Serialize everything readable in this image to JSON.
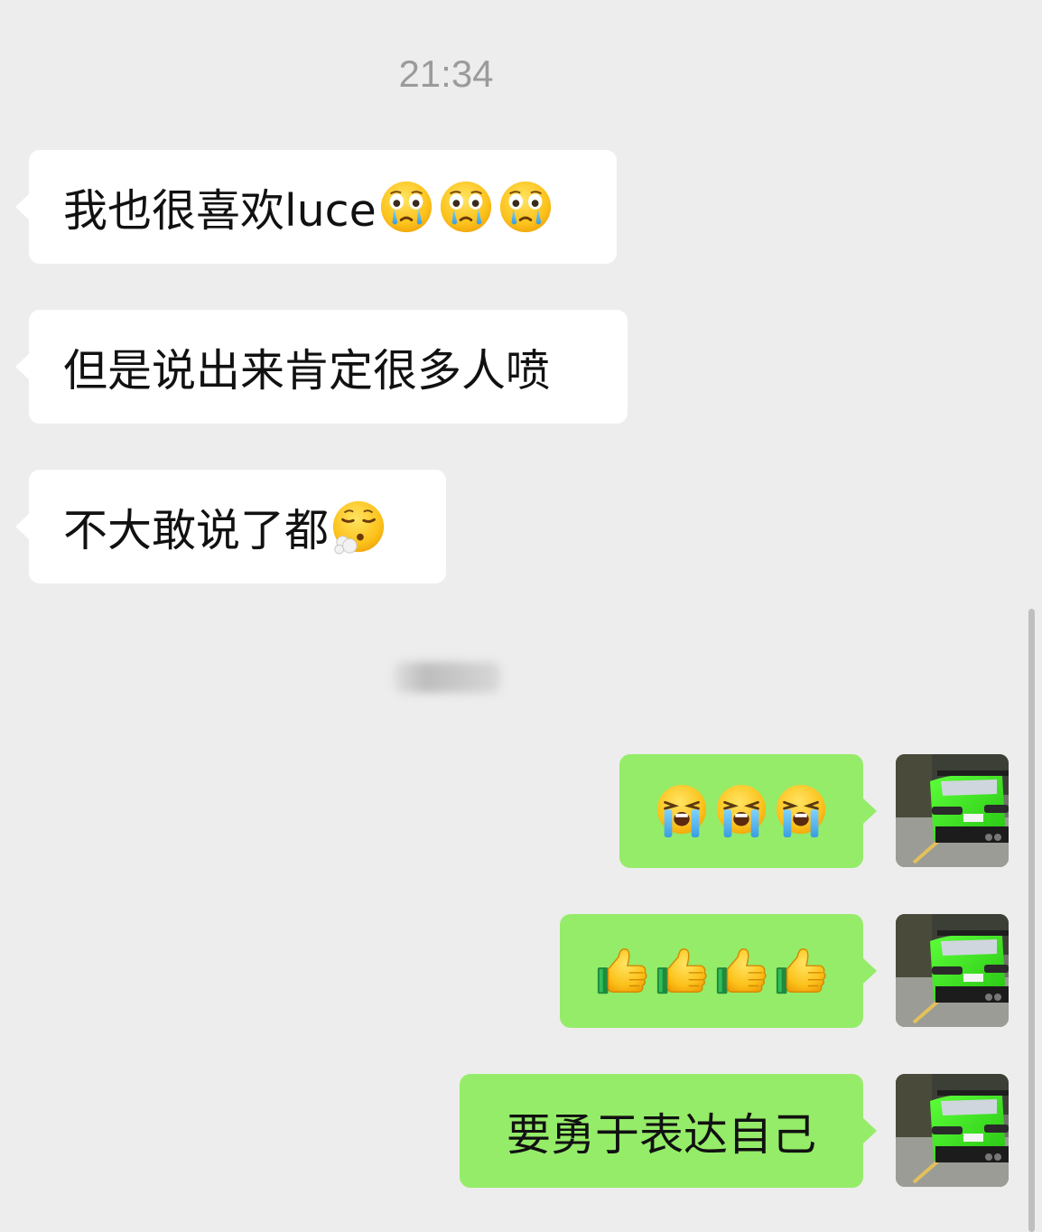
{
  "chat": {
    "timestamp": "21:34",
    "messages": [
      {
        "side": "incoming",
        "text": "我也很喜欢luce",
        "emoji": [
          "crying-face-icon",
          "crying-face-icon",
          "crying-face-icon"
        ]
      },
      {
        "side": "incoming",
        "text": "但是说出来肯定很多人喷",
        "emoji": []
      },
      {
        "side": "incoming",
        "text": "不大敢说了都",
        "emoji": [
          "face-exhaling-icon"
        ]
      },
      {
        "side": "outgoing",
        "text": "",
        "emoji": [
          "loudly-crying-face-icon",
          "loudly-crying-face-icon",
          "loudly-crying-face-icon"
        ]
      },
      {
        "side": "outgoing",
        "text": "",
        "emoji": [
          "thumbs-up-icon",
          "thumbs-up-icon",
          "thumbs-up-icon",
          "thumbs-up-icon"
        ]
      },
      {
        "side": "outgoing",
        "text": "要勇于表达自己",
        "emoji": []
      }
    ]
  },
  "colors": {
    "background": "#ededed",
    "incoming_bubble": "#ffffff",
    "outgoing_bubble": "#95ec69",
    "timestamp_text": "#9b9b9b"
  },
  "avatar": {
    "subject": "green sports car rear view"
  }
}
